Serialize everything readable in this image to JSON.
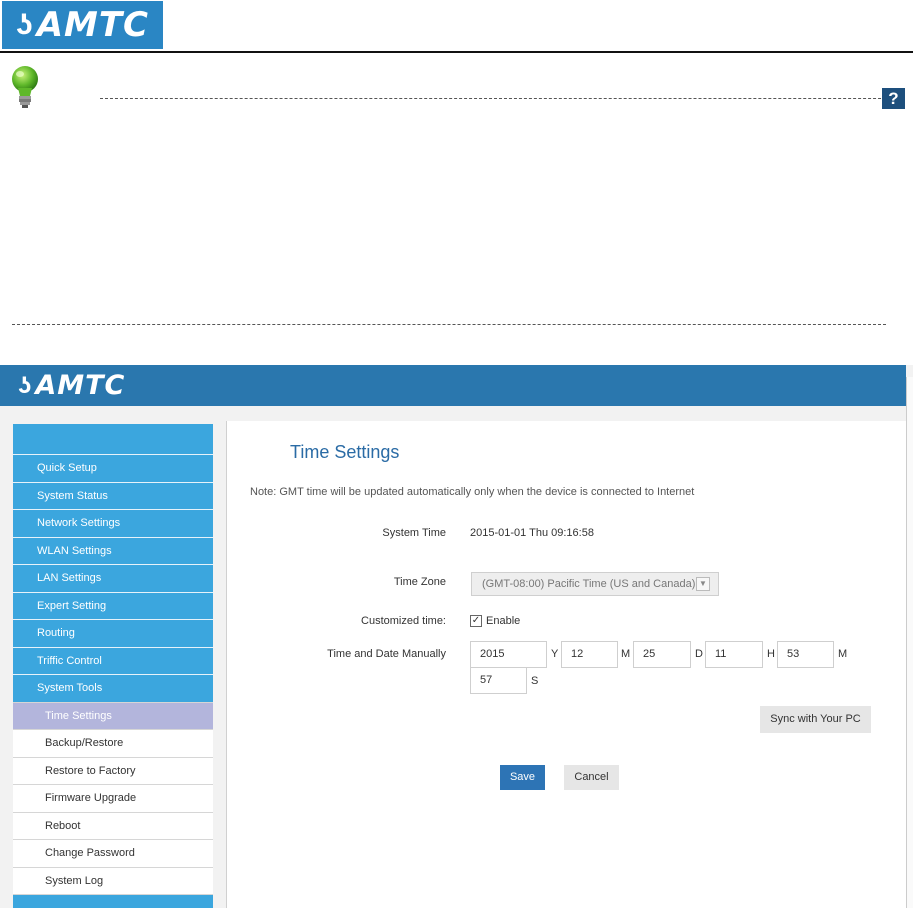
{
  "doc": {
    "logo_text": "AMTC"
  },
  "app": {
    "logo_text": "AMTC",
    "help_label": "?",
    "sidebar": {
      "main_items": [
        "Quick Setup",
        "System Status",
        "Network Settings",
        "WLAN Settings",
        "LAN Settings",
        "Expert Setting",
        "Routing",
        "Triffic Control",
        "System Tools"
      ],
      "sub_items": [
        "Time Settings",
        "Backup/Restore",
        "Restore to Factory",
        "Firmware Upgrade",
        "Reboot",
        "Change Password",
        "System Log"
      ],
      "active_item": "Time Settings"
    },
    "main": {
      "title": "Time Settings",
      "note": "Note: GMT time will be updated automatically only when the device is connected to Internet",
      "system_time_label": "System Time",
      "system_time_value": "2015-01-01 Thu 09:16:58",
      "time_zone_label": "Time Zone",
      "time_zone_value": "(GMT-08:00) Pacific Time (US and Canada)",
      "customized_label": "Customized time:",
      "enable_label": "Enable",
      "enable_checked": true,
      "manual_label": "Time and Date Manually",
      "fields": {
        "year": "2015",
        "year_unit": "Y",
        "month": "12",
        "month_unit": "M",
        "day": "25",
        "day_unit": "D",
        "hour": "11",
        "hour_unit": "H",
        "minute": "53",
        "minute_unit": "M",
        "second": "57",
        "second_unit": "S"
      },
      "sync_button": "Sync with Your PC",
      "save_button": "Save",
      "cancel_button": "Cancel"
    }
  },
  "colors": {
    "brand_blue": "#2a77ae",
    "sidebar_blue": "#3ba6de",
    "active_item": "#b3b5dc",
    "save_button": "#2d74b5"
  }
}
